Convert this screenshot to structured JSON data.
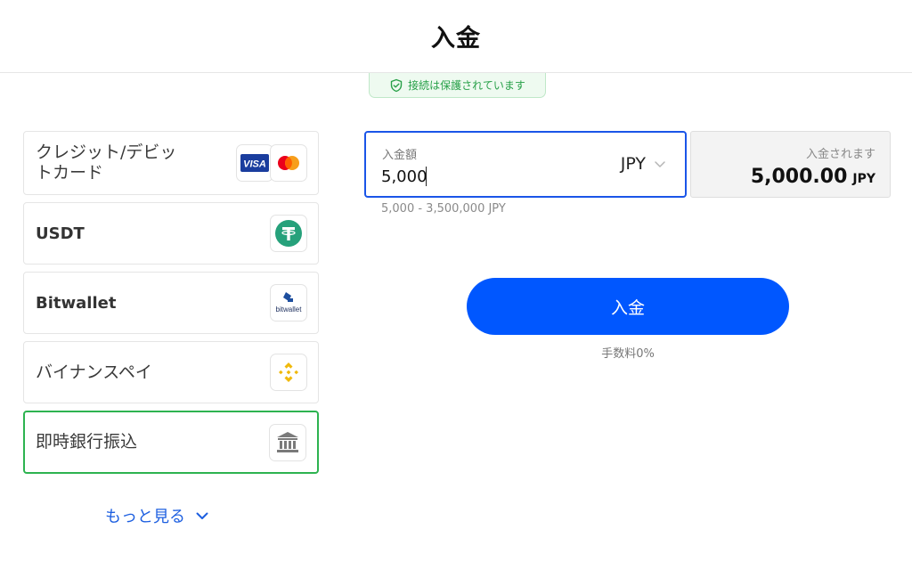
{
  "header": {
    "title": "入金"
  },
  "security": {
    "text": "接続は保護されています",
    "icon": "shield-check-icon",
    "color": "#27a048"
  },
  "methods": [
    {
      "label": "クレジット/デビットカード",
      "logos": [
        "visa-logo",
        "mastercard-logo"
      ],
      "selected": false
    },
    {
      "label": "USDT",
      "logos": [
        "tether-logo"
      ],
      "selected": false
    },
    {
      "label": "Bitwallet",
      "logos": [
        "bitwallet-logo"
      ],
      "logo_text": "bitwallet",
      "selected": false
    },
    {
      "label": "バイナンスペイ",
      "logos": [
        "binance-logo"
      ],
      "selected": false
    },
    {
      "label": "即時銀行振込",
      "logos": [
        "bank-icon"
      ],
      "selected": true
    }
  ],
  "visa_text": "VISA",
  "more": {
    "label": "もっと見る",
    "icon": "chevron-down-icon"
  },
  "amount": {
    "label": "入金額",
    "value": "5,000",
    "currency": "JPY",
    "range": "5,000 - 3,500,000 JPY"
  },
  "receive": {
    "label": "入金されます",
    "amount": "5,000.00",
    "currency": "JPY"
  },
  "deposit": {
    "button_label": "入金",
    "fee_note": "手数料0%"
  },
  "colors": {
    "accent": "#0057ff",
    "selected_border": "#2db350",
    "link": "#1d5fe0",
    "tether": "#26a17b",
    "binance": "#f0b90b"
  }
}
